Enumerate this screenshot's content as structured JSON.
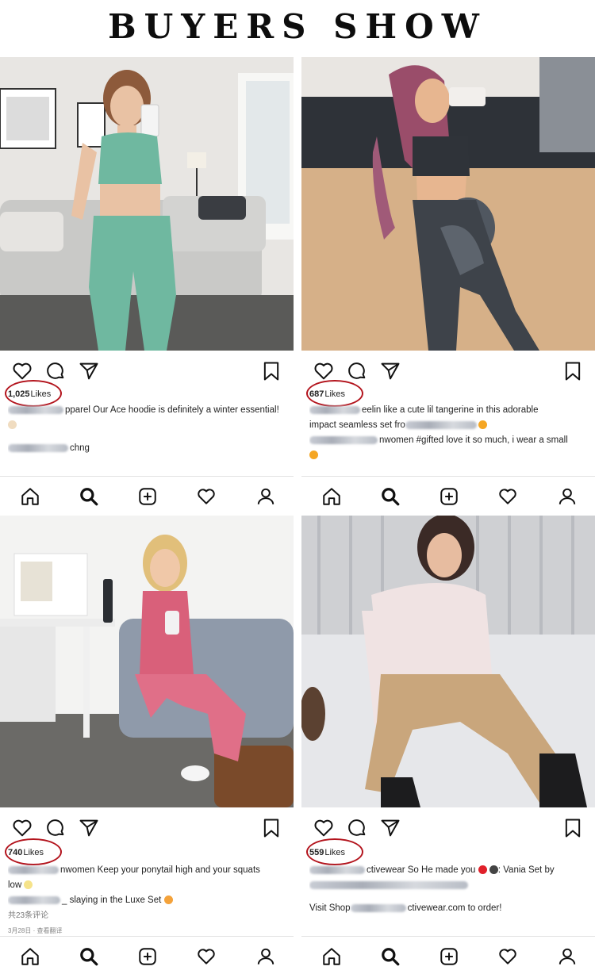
{
  "banner": {
    "title": "BUYERS SHOW"
  },
  "posts": [
    {
      "likes_count": "1,025",
      "likes_word": "Likes",
      "caption_lines": [
        "pparel Our Ace hoodie is definitely a winter essential!",
        "",
        "chng"
      ],
      "colors": {
        "outfit": "#6fb8a0",
        "bg": "#e9e9ea"
      }
    },
    {
      "likes_count": "687",
      "likes_word": "Likes",
      "caption_lines": [
        "eelin like a cute lil tangerine in this adorable",
        "impact seamless set fro",
        "nwomen #gifted love it so much, i wear a small",
        ""
      ],
      "colors": {
        "outfit": "#3a3f46",
        "bg": "#d8b58e"
      }
    },
    {
      "likes_count": "740",
      "likes_word": "Likes",
      "caption_lines": [
        "nwomen Keep your ponytail high and your squats",
        "low",
        "_ slaying in the Luxe Set",
        "共23条评论",
        "3月28日 · 查看翻译"
      ],
      "colors": {
        "outfit": "#d9607a",
        "bg": "#f2f2f2"
      }
    },
    {
      "likes_count": "559",
      "likes_word": "Likes",
      "caption_lines": [
        "ctivewear So He made you",
        ": Vania Set by",
        "",
        "Visit Shop",
        "ctivewear.com to order!"
      ],
      "colors": {
        "outfit": "#c9a67c",
        "bg": "#cfd0d3"
      }
    }
  ],
  "icons": {
    "actions": [
      "heart-icon",
      "comment-icon",
      "send-icon",
      "bookmark-icon"
    ],
    "tabs": [
      "home-icon",
      "search-icon",
      "add-icon",
      "heart-icon",
      "profile-icon"
    ]
  },
  "accent": {
    "ring": "#b3141d"
  }
}
